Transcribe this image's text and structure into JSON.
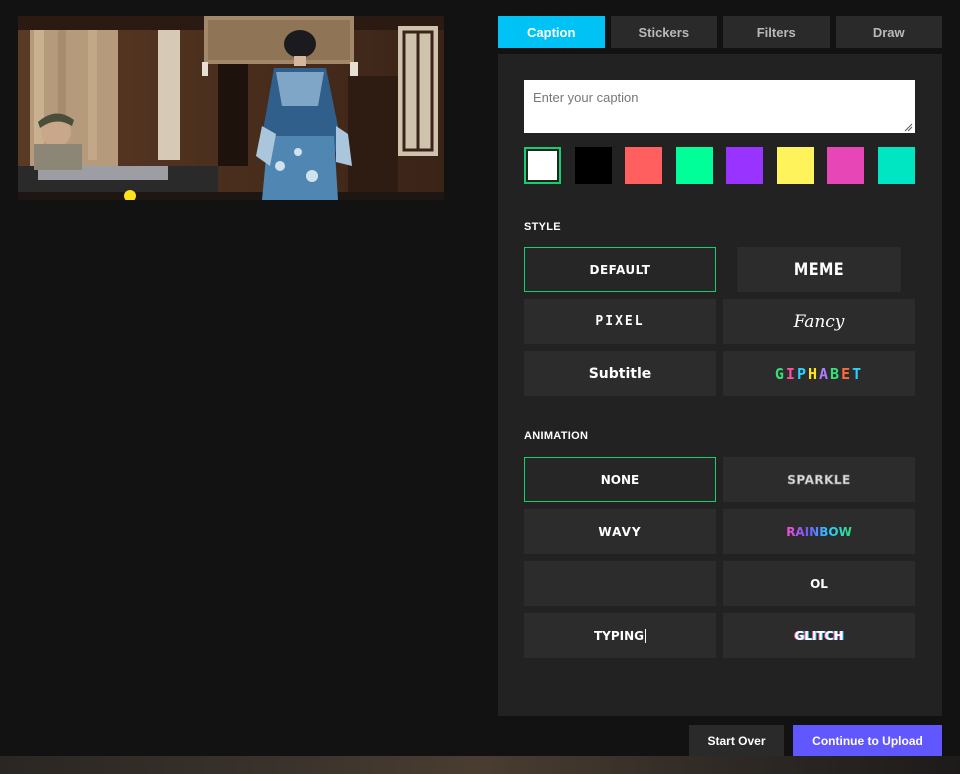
{
  "tabs": [
    {
      "label": "Caption",
      "active": true
    },
    {
      "label": "Stickers",
      "active": false
    },
    {
      "label": "Filters",
      "active": false
    },
    {
      "label": "Draw",
      "active": false
    }
  ],
  "caption": {
    "value": "",
    "placeholder": "Enter your caption"
  },
  "colors": {
    "swatches": [
      "#ffffff",
      "#000000",
      "#ff5f5f",
      "#00ff99",
      "#9933ff",
      "#fff35c",
      "#e646b6",
      "#00e6c3"
    ],
    "selected_index": 0,
    "accent": "#13d06f",
    "tab_active": "#00c2f5",
    "primary_button": "#6157ff"
  },
  "style": {
    "label": "STYLE",
    "options": [
      "DEFAULT",
      "MEME",
      "PIXEL",
      "Fancy",
      "Subtitle",
      "GIPHABET"
    ],
    "selected": "DEFAULT"
  },
  "animation": {
    "label": "ANIMATION",
    "options": [
      "NONE",
      "SPARKLE",
      "WAVY",
      "RAINBOW",
      "",
      "OL",
      "TYPING",
      "GLITCH"
    ],
    "selected": "NONE"
  },
  "buttons": {
    "start_over": "Start Over",
    "continue": "Continue to Upload"
  }
}
